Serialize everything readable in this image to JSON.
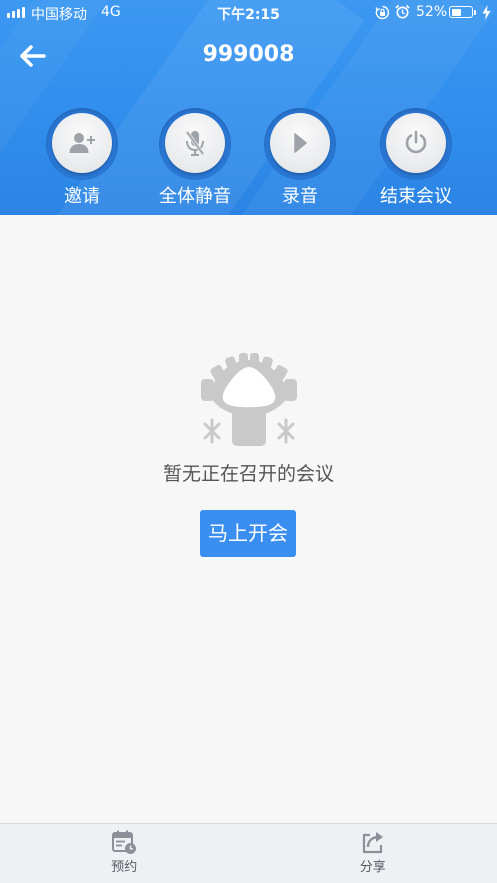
{
  "status_bar": {
    "carrier": "中国移动",
    "network": "4G",
    "time": "下午2:15",
    "battery_text": "52%",
    "battery_level": 0.52
  },
  "header": {
    "title": "999008"
  },
  "actions": [
    {
      "label": "邀请",
      "icon": "invite-user-icon"
    },
    {
      "label": "全体静音",
      "icon": "mute-microphone-icon"
    },
    {
      "label": "录音",
      "icon": "play-icon"
    },
    {
      "label": "结束会议",
      "icon": "power-icon"
    }
  ],
  "empty_state": {
    "icon": "conference-table-icon",
    "message": "暂无正在召开的会议",
    "button_label": "马上开会"
  },
  "tab_bar": {
    "items": [
      {
        "label": "预约",
        "icon": "calendar-schedule-icon"
      },
      {
        "label": "分享",
        "icon": "share-icon"
      }
    ]
  },
  "colors": {
    "header_blue": "#3290ee",
    "ring_blue": "#2a79d8",
    "button_blue": "#3a8ef0",
    "icon_gray": "#9ea3a9",
    "illustration_gray": "#c9c9c9",
    "background": "#f7f7f7"
  }
}
